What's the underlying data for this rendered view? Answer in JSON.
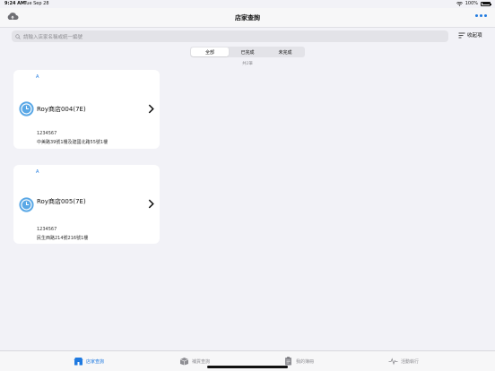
{
  "status_bar": {
    "time": "9:24 AM",
    "date": "Tue Sep 28",
    "battery": "100%"
  },
  "nav": {
    "title": "店家查詢"
  },
  "search": {
    "placeholder": "請輸入店家名稱或統一編號",
    "collapse_label": "收起項"
  },
  "segments": [
    {
      "label": "全部",
      "active": true
    },
    {
      "label": "已完成",
      "active": false
    },
    {
      "label": "未完成",
      "active": false
    }
  ],
  "count_text": "共2筆",
  "stores": [
    {
      "tag": "A",
      "name": "Roy商店004(7E)",
      "phone": "1234567",
      "address": "中美路39號1樓及建國北路55號1樓"
    },
    {
      "tag": "A",
      "name": "Roy商店005(7E)",
      "phone": "1234567",
      "address": "民生西路214號216號1樓"
    }
  ],
  "tabs": [
    {
      "label": "店家查詢",
      "icon": "store-icon",
      "active": true
    },
    {
      "label": "補貨查詢",
      "icon": "box-icon",
      "active": false
    },
    {
      "label": "我的簿冊",
      "icon": "clipboard-icon",
      "active": false
    },
    {
      "label": "活動執行",
      "icon": "activity-icon",
      "active": false
    }
  ],
  "colors": {
    "accent": "#1f7ae0",
    "background": "#f2f2f7"
  }
}
